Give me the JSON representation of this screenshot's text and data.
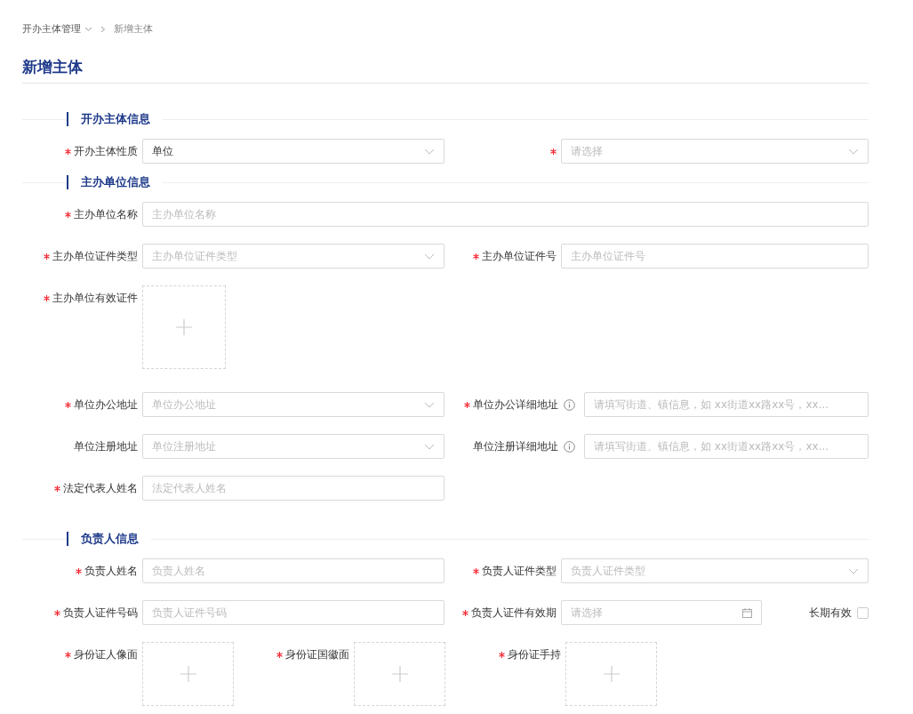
{
  "breadcrumb": [
    {
      "label": "开办主体管理",
      "dropdown": true
    },
    {
      "label": "新增主体",
      "dropdown": false
    }
  ],
  "page_title": "新增主体",
  "sections": [
    {
      "title": "开办主体信息",
      "rows": [
        {
          "kind": "pair",
          "items": [
            {
              "label": "开办主体性质",
              "required": true,
              "kind": "select",
              "value": "单位"
            },
            {
              "required": true,
              "kind": "select",
              "placeholder": "请选择"
            }
          ]
        }
      ]
    },
    {
      "title": "主办单位信息",
      "rows": [
        {
          "kind": "full",
          "items": [
            {
              "label": "主办单位名称",
              "required": true,
              "kind": "text",
              "placeholder": "主办单位名称"
            }
          ]
        },
        {
          "kind": "pair",
          "items": [
            {
              "label": "主办单位证件类型",
              "required": true,
              "kind": "select",
              "placeholder": "主办单位证件类型"
            },
            {
              "label": "主办单位证件号",
              "required": true,
              "kind": "text",
              "placeholder": "主办单位证件号"
            }
          ]
        },
        {
          "kind": "pair",
          "items": [
            {
              "label": "主办单位有效证件",
              "required": true,
              "kind": "upload"
            }
          ]
        },
        {
          "kind": "pair",
          "items": [
            {
              "label": "单位办公地址",
              "required": true,
              "kind": "select",
              "placeholder": "单位办公地址"
            },
            {
              "label": "单位办公详细地址",
              "required": true,
              "info": true,
              "kind": "text",
              "placeholder": "请填写街道、镇信息，如 xx街道xx路xx号，xx..."
            }
          ]
        },
        {
          "kind": "pair",
          "items": [
            {
              "label": "单位注册地址",
              "required": false,
              "kind": "select",
              "placeholder": "单位注册地址"
            },
            {
              "label": "单位注册详细地址",
              "required": false,
              "info": true,
              "kind": "text",
              "placeholder": "请填写街道、镇信息，如 xx街道xx路xx号，xx..."
            }
          ]
        },
        {
          "kind": "pair",
          "items": [
            {
              "label": "法定代表人姓名",
              "required": true,
              "kind": "text",
              "placeholder": "法定代表人姓名"
            }
          ]
        }
      ]
    },
    {
      "title": "负责人信息",
      "rows": [
        {
          "kind": "pair",
          "items": [
            {
              "label": "负责人姓名",
              "required": true,
              "kind": "text",
              "placeholder": "负责人姓名"
            },
            {
              "label": "负责人证件类型",
              "required": true,
              "kind": "select",
              "placeholder": "负责人证件类型"
            }
          ]
        },
        {
          "kind": "pair",
          "items": [
            {
              "label": "负责人证件号码",
              "required": true,
              "kind": "text",
              "placeholder": "负责人证件号码"
            },
            {
              "label": "负责人证件有效期",
              "required": true,
              "kind": "date",
              "placeholder": "请选择",
              "extra": {
                "label": "长期有效",
                "checked": false
              }
            }
          ]
        },
        {
          "kind": "triple",
          "items": [
            {
              "label": "身份证人像面",
              "required": true,
              "kind": "upload"
            },
            {
              "label": "身份证国徽面",
              "required": true,
              "kind": "upload"
            },
            {
              "label": "身份证手持",
              "required": true,
              "kind": "upload"
            }
          ]
        }
      ]
    }
  ]
}
